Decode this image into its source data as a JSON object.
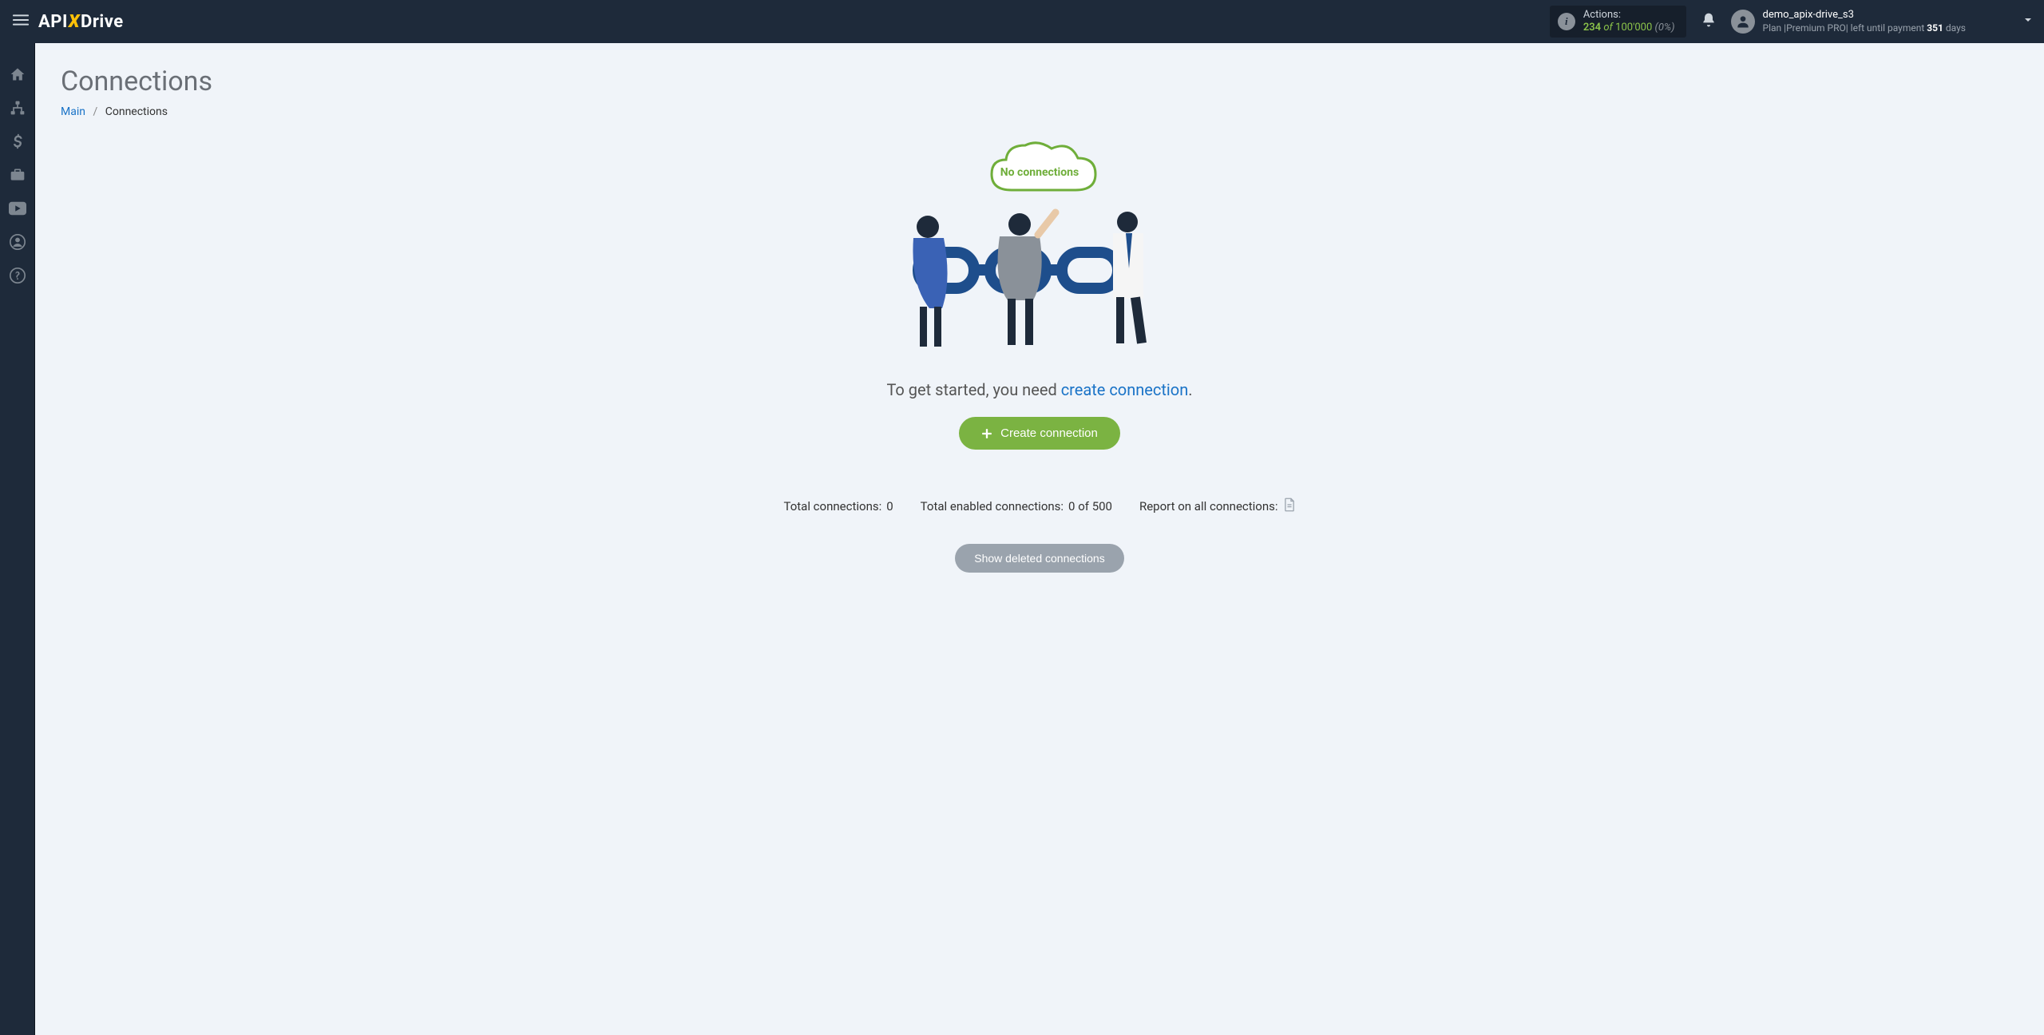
{
  "header": {
    "logo_api": "API",
    "logo_x": "X",
    "logo_drive": "Drive",
    "actions": {
      "label": "Actions:",
      "count": "234",
      "of": "of",
      "total": "100'000",
      "pct": "(0%)"
    },
    "user": {
      "name": "demo_apix-drive_s3",
      "plan_prefix": "Plan |",
      "plan_name": "Premium PRO",
      "plan_mid": "| left until payment ",
      "days": "351",
      "plan_suffix": " days"
    }
  },
  "sidebar": {
    "items": [
      {
        "name": "home"
      },
      {
        "name": "sitemap"
      },
      {
        "name": "dollar"
      },
      {
        "name": "briefcase"
      },
      {
        "name": "youtube"
      },
      {
        "name": "user"
      },
      {
        "name": "help"
      }
    ]
  },
  "page": {
    "title": "Connections",
    "breadcrumb_main": "Main",
    "breadcrumb_current": "Connections"
  },
  "empty": {
    "cloud_text": "No connections",
    "lead_text": "To get started, you need ",
    "link_text": "create connection",
    "lead_suffix": ".",
    "button_label": "Create connection"
  },
  "stats": {
    "total_label": "Total connections: ",
    "total_value": "0",
    "enabled_label": "Total enabled connections: ",
    "enabled_value": "0 of 500",
    "report_label": "Report on all connections:"
  },
  "deleted_btn": "Show deleted connections"
}
